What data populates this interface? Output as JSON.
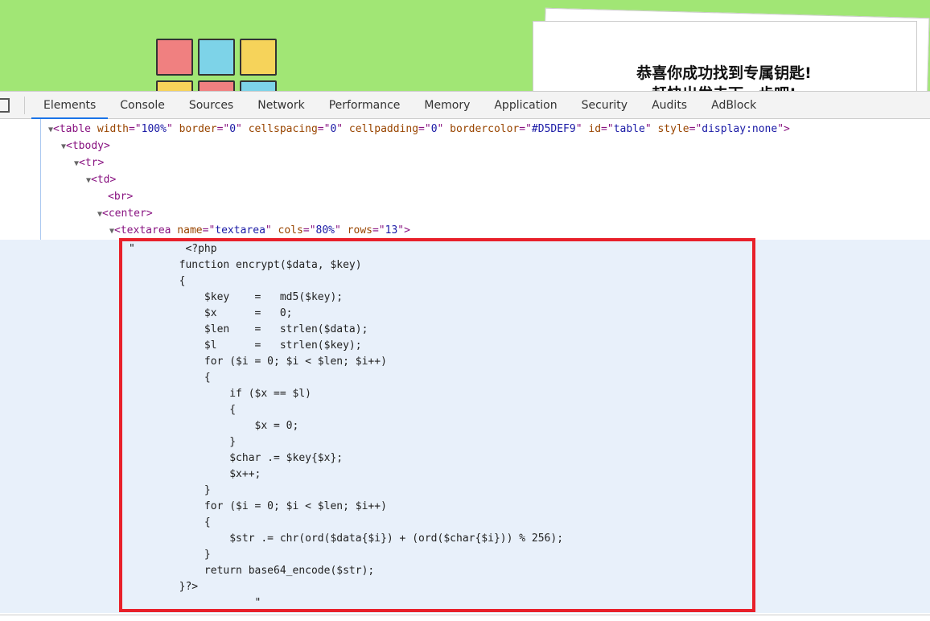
{
  "page": {
    "message_line1": "恭喜你成功找到专属钥匙!",
    "message_line2": "赶快出发去下一步吧!",
    "colors": {
      "background": "#a1e675",
      "highlight_box": "#e8202a",
      "selected_row": "#e8f0fa"
    }
  },
  "devtools": {
    "tabs": [
      "Elements",
      "Console",
      "Sources",
      "Network",
      "Performance",
      "Memory",
      "Application",
      "Security",
      "Audits",
      "AdBlock"
    ],
    "active_tab": "Elements"
  },
  "tree": {
    "table": {
      "tag": "table",
      "attrs": [
        [
          "width",
          "100%"
        ],
        [
          "border",
          "0"
        ],
        [
          "cellspacing",
          "0"
        ],
        [
          "cellpadding",
          "0"
        ],
        [
          "bordercolor",
          "#D5DEF9"
        ],
        [
          "id",
          "table"
        ],
        [
          "style",
          "display:none"
        ]
      ]
    },
    "tbody": "tbody",
    "tr": "tr",
    "td": "td",
    "br": "br",
    "center": "center",
    "textarea": {
      "tag": "textarea",
      "attrs": [
        [
          "name",
          "textarea"
        ],
        [
          "cols",
          "80%"
        ],
        [
          "rows",
          "13"
        ]
      ]
    },
    "text_content": "\"        <?php\n        function encrypt($data, $key)\n        {\n            $key    =   md5($key);\n            $x      =   0;\n            $len    =   strlen($data);\n            $l      =   strlen($key);\n            for ($i = 0; $i < $len; $i++)\n            {\n                if ($x == $l)\n                {\n                    $x = 0;\n                }\n                $char .= $key{$x};\n                $x++;\n            }\n            for ($i = 0; $i < $len; $i++)\n            {\n                $str .= chr(ord($data{$i}) + (ord($char{$i})) % 256);\n            }\n            return base64_encode($str);\n        }?>\n                    \""
  }
}
